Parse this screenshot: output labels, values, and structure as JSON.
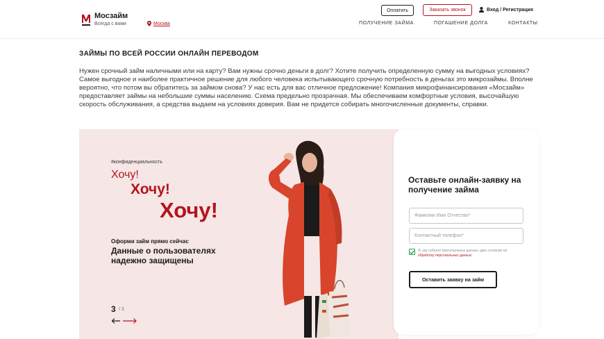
{
  "header": {
    "brand_name": "Мосзайм",
    "brand_tagline": "Всегда с вами",
    "city": "Москва",
    "pay_button": "Оплатить",
    "call_button": "Заказать звонок",
    "login_link": "Вход / Регистрация",
    "nav": [
      "ПОЛУЧЕНИЕ ЗАЙМА",
      "ПОГАШЕНИЕ ДОЛГА",
      "КОНТАКТЫ"
    ]
  },
  "article": {
    "title": "ЗАЙМЫ ПО ВСЕЙ РОССИИ ОНЛАЙН ПЕРЕВОДОМ",
    "body": "Нужен срочный займ наличными или на карту? Вам нужны срочно деньги в долг? Хотите получить определенную сумму на выгодных условиях? Самое выгодное и наиболее практичное решение для любого человека испытывающего срочную потребность в деньгах это микрозаймы. Вполне вероятно, что потом вы обратитесь за займом снова? У нас есть для вас отличное предложение! Компания микрофинансирования «Мосзайм» предоставляет займы на небольшие суммы населению. Схема предельно прозрачная. Мы обеспечиваем комфортные условия, высочайшую скорость обслуживания, а средства выдаем на условиях доверия. Вам не придется собирать многочисленные документы, справки."
  },
  "banner": {
    "hashtag": "#конфиденциальность",
    "want_1": "Хочу!",
    "want_2": "Хочу!",
    "want_3": "Хочу!",
    "cta_small": "Оформи займ прямо сейчас",
    "cta_big": "Данные о пользователях надежно защищены",
    "slide_current": "3",
    "slide_total": "/ 3"
  },
  "form": {
    "title": "Оставьте онлайн-заявку на получение займа",
    "name_placeholder": "Фамилия Имя Отчество*",
    "phone_placeholder": "Контактный телефон*",
    "consent_text": "Я, как субъект персональных данных, даю согласие на ",
    "consent_link": "обработку персональных данных",
    "submit_label": "Оставить заявку на займ"
  },
  "colors": {
    "accent": "#b5141d",
    "banner_bg": "#f6e6e6",
    "checkbox": "#2e9c4b",
    "coat": "#d8452c"
  },
  "icons": {
    "logo": "m-logo-icon",
    "city": "location-pin-icon",
    "login": "user-icon",
    "prev": "arrow-left-icon",
    "next": "arrow-right-icon",
    "check": "checkmark-icon"
  }
}
